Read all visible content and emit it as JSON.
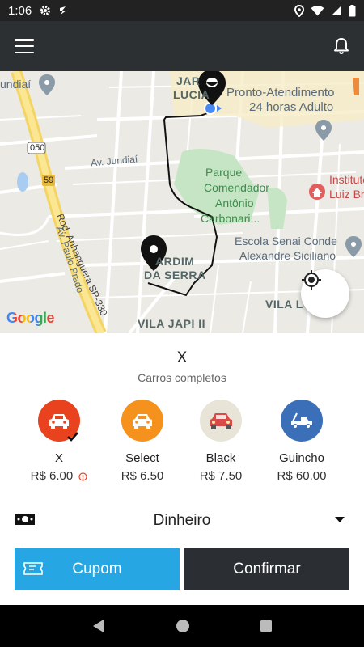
{
  "status_bar": {
    "time": "1:06"
  },
  "map": {
    "labels": {
      "jundiai": "undiaí",
      "jardim_lucia_1": "JAR",
      "jardim_lucia_2": "LUCIA",
      "pronto_1": "Pronto-Atendimento",
      "pronto_2": "24 horas Adulto",
      "route_050": "050",
      "route_59": "59",
      "av_jundiai": "Av. Jundiaí",
      "av_paulo_prado": "Av. Paulo Prado",
      "rod_anhanguera": "Rod. Anhanguera SP-330",
      "parque_1": "Parque",
      "parque_2": "Comendador",
      "parque_3": "Antônio",
      "parque_4": "Carbonari...",
      "instituto_1": "Instituto",
      "instituto_2": "Luiz Br",
      "escola_1": "Escola Senai Conde",
      "escola_2": "Alexandre Siciliano",
      "jardim_serra_1": "ARDIM",
      "jardim_serra_2": "DA SERRA",
      "vila_lo": "VILA LO",
      "vila_japi": "VILA JAPI II",
      "google": "Google"
    }
  },
  "panel": {
    "service_title": "X",
    "service_subtitle": "Carros completos",
    "options": [
      {
        "name": "X",
        "price": "R$ 6.00",
        "color": "#e8421f",
        "selected": true
      },
      {
        "name": "Select",
        "price": "R$ 6.50",
        "color": "#f5921d",
        "selected": false
      },
      {
        "name": "Black",
        "price": "R$ 7.50",
        "color": "#e8e4d8",
        "selected": false
      },
      {
        "name": "Guincho",
        "price": "R$ 60.00",
        "color": "#3b6fb8",
        "selected": false
      }
    ],
    "payment_method": "Dinheiro",
    "coupon_label": "Cupom",
    "confirm_label": "Confirmar"
  },
  "colors": {
    "accent": "#27a6e4",
    "dark": "#2b2f33",
    "app_bar": "#2d3033"
  }
}
